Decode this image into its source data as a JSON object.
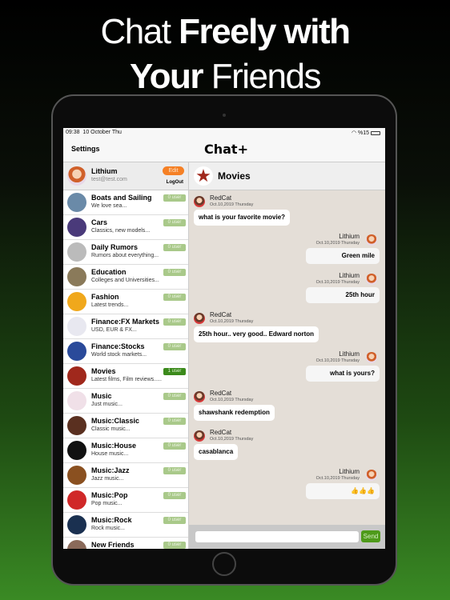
{
  "promo": {
    "line1_light": "Chat ",
    "line1_bold": "Freely with",
    "line2_bold": "Your",
    "line2_light": " Friends"
  },
  "status": {
    "time": "09:38",
    "date": "10 October Thu",
    "battery": "%15",
    "wifi_icon": "wifi-icon"
  },
  "nav": {
    "settings": "Settings",
    "title": "Chat+"
  },
  "profile": {
    "name": "Lithium",
    "email": "test@test.com",
    "edit": "Edit",
    "logout": "LogOut"
  },
  "colors": {
    "accent_green": "#4e9a1a",
    "badge_inactive": "#a9c98a",
    "edit_orange": "#f58025"
  },
  "rooms": [
    {
      "title": "Boats and Sailing",
      "subtitle": "We love sea...",
      "badge": "0 user",
      "color": "#6a8aa8"
    },
    {
      "title": "Cars",
      "subtitle": "Classics, new models...",
      "badge": "0 user",
      "color": "#4a3a7a"
    },
    {
      "title": "Daily Rumors",
      "subtitle": "Rumors about everything...",
      "badge": "0 user",
      "color": "#bbb"
    },
    {
      "title": "Education",
      "subtitle": "Colleges and Universities...",
      "badge": "0 user",
      "color": "#8a7a5a"
    },
    {
      "title": "Fashion",
      "subtitle": "Latest trends...",
      "badge": "0 user",
      "color": "#f0a81c"
    },
    {
      "title": "Finance:FX Markets",
      "subtitle": "USD, EUR & FX...",
      "badge": "0 user",
      "color": "#e8e8f0"
    },
    {
      "title": "Finance:Stocks",
      "subtitle": "World stock markets...",
      "badge": "0 user",
      "color": "#2a4a9a"
    },
    {
      "title": "Movies",
      "subtitle": "Latest films, Film reviews.....",
      "badge": "1 user",
      "color": "#a0281c",
      "active": true
    },
    {
      "title": "Music",
      "subtitle": "Just music...",
      "badge": "0 user",
      "color": "#f0e0e8"
    },
    {
      "title": "Music:Classic",
      "subtitle": "Classic music...",
      "badge": "0 user",
      "color": "#5a3020"
    },
    {
      "title": "Music:House",
      "subtitle": "House music...",
      "badge": "0 user",
      "color": "#111"
    },
    {
      "title": "Music:Jazz",
      "subtitle": "Jazz music...",
      "badge": "0 user",
      "color": "#8a5020"
    },
    {
      "title": "Music:Pop",
      "subtitle": "Pop music...",
      "badge": "0 user",
      "color": "#d02828"
    },
    {
      "title": "Music:Rock",
      "subtitle": "Rock music...",
      "badge": "0 user",
      "color": "#1a3050"
    },
    {
      "title": "New Friends",
      "subtitle": "",
      "badge": "0 user",
      "color": "#8a6a5a"
    }
  ],
  "chat": {
    "title": "Movies",
    "messages": [
      {
        "side": "left",
        "name": "RedCat",
        "date": "Oct.10,2019 Thursday",
        "text": "what is your favorite movie?"
      },
      {
        "side": "right",
        "name": "Lithium",
        "date": "Oct.10,2019 Thursday",
        "text": "Green mile"
      },
      {
        "side": "right",
        "name": "Lithium",
        "date": "Oct.10,2019 Thursday",
        "text": "25th hour"
      },
      {
        "side": "left",
        "name": "RedCat",
        "date": "Oct.10,2019 Thursday",
        "text": "25th hour.. very good.. Edward norton"
      },
      {
        "side": "right",
        "name": "Lithium",
        "date": "Oct.10,2019 Thursday",
        "text": "what is yours?"
      },
      {
        "side": "left",
        "name": "RedCat",
        "date": "Oct.10,2019 Thursday",
        "text": "shawshank redemption"
      },
      {
        "side": "left",
        "name": "RedCat",
        "date": "Oct.10,2019 Thursday",
        "text": "casablanca"
      },
      {
        "side": "right",
        "name": "Lithium",
        "date": "Oct.10,2019 Thursday",
        "text": "👍👍👍"
      }
    ],
    "input_value": "",
    "send": "Send"
  }
}
